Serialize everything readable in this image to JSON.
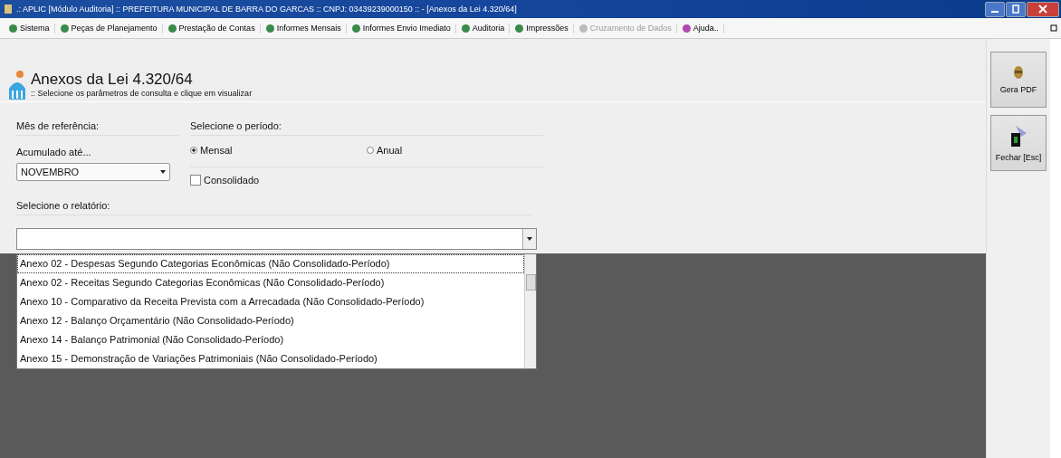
{
  "window": {
    "title": ".: APLIC [Módulo Auditoria] :: PREFEITURA MUNICIPAL DE BARRA DO GARCAS :: CNPJ: 03439239000150 :: - [Anexos da Lei 4.320/64]"
  },
  "menu": [
    {
      "label": "Sistema",
      "disabled": false
    },
    {
      "label": "Peças de Planejamento",
      "disabled": false
    },
    {
      "label": "Prestação de Contas",
      "disabled": false
    },
    {
      "label": "Informes Mensais",
      "disabled": false
    },
    {
      "label": "Informes Envio Imediato",
      "disabled": false
    },
    {
      "label": "Auditoria",
      "disabled": false
    },
    {
      "label": "Impressões",
      "disabled": false
    },
    {
      "label": "Cruzamento de Dados",
      "disabled": true
    },
    {
      "label": "Ajuda..",
      "disabled": false
    }
  ],
  "header": {
    "title": "Anexos da Lei 4.320/64",
    "subtitle": ":: Selecione os parâmetros de consulta e clique em visualizar"
  },
  "month": {
    "group_label": "Mês de referência:",
    "label": "Acumulado até...",
    "value": "NOVEMBRO"
  },
  "period": {
    "group_label": "Selecione o período:",
    "options": [
      {
        "label": "Mensal",
        "selected": true
      },
      {
        "label": "Anual",
        "selected": false
      }
    ]
  },
  "consolidated": {
    "label": "Consolidado",
    "checked": false
  },
  "report": {
    "label": "Selecione o relatório:",
    "items": [
      {
        "label": "Anexo 02 - Despesas Segundo Categorias Econômicas (Não Consolidado-Período)",
        "selected": true
      },
      {
        "label": "Anexo 02 - Receitas Segundo Categorias Econômicas (Não Consolidado-Período)",
        "selected": false
      },
      {
        "label": "Anexo 10 - Comparativo da Receita Prevista com a Arrecadada (Não Consolidado-Período)",
        "selected": false
      },
      {
        "label": "Anexo 12 - Balanço Orçamentário (Não Consolidado-Período)",
        "selected": false
      },
      {
        "label": "Anexo 14 - Balanço Patrimonial (Não Consolidado-Período)",
        "selected": false
      },
      {
        "label": "Anexo 15 - Demonstração de Variações Patrimoniais (Não Consolidado-Período)",
        "selected": false
      }
    ]
  },
  "actions": [
    {
      "label": "Gera PDF",
      "kind": "pdf"
    },
    {
      "label": "Fechar [Esc]",
      "kind": "close"
    }
  ]
}
